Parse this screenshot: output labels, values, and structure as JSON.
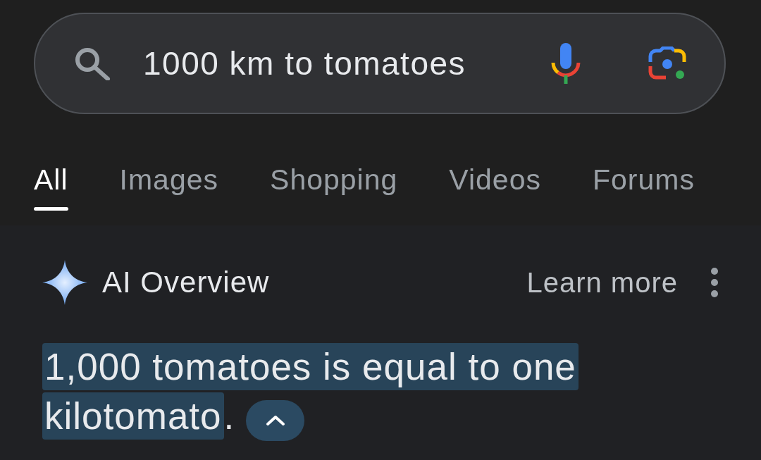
{
  "search": {
    "query": "1000 km to tomatoes"
  },
  "tabs": [
    {
      "label": "All",
      "selected": true
    },
    {
      "label": "Images",
      "selected": false
    },
    {
      "label": "Shopping",
      "selected": false
    },
    {
      "label": "Videos",
      "selected": false
    },
    {
      "label": "Forums",
      "selected": false
    }
  ],
  "ai_overview": {
    "title": "AI Overview",
    "learn_more": "Learn more",
    "answer": [
      {
        "text": "1,000 tomatoes is equal to one kilotomato",
        "highlighted": true
      },
      {
        "text": ".",
        "highlighted": false
      }
    ],
    "expanded": true
  }
}
